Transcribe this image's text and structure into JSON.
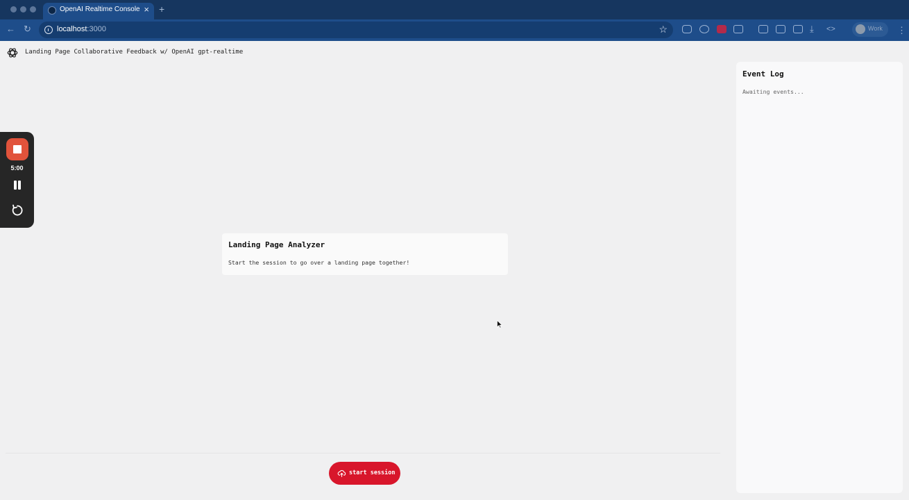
{
  "browser": {
    "tab_title": "OpenAI Realtime Console",
    "tab_close": "×",
    "new_tab": "+",
    "url_host": "localhost",
    "url_port": ":3000",
    "profile_label": "Work",
    "icons": [
      "back-icon",
      "reload-icon",
      "site-info-icon",
      "bookmark-star-icon",
      "extension-icons",
      "download-icon",
      "devtools-icon",
      "menu-icon"
    ]
  },
  "header": {
    "title": "Landing Page Collaborative Feedback w/ OpenAI gpt-realtime",
    "logo_icon": "openai-logo-icon"
  },
  "recorder": {
    "time": "5:00",
    "icons": [
      "stop-record-icon",
      "pause-icon",
      "restart-icon"
    ],
    "stop_color": "#e1533b"
  },
  "main": {
    "card_title": "Landing Page Analyzer",
    "card_subtitle": "Start the session to go over a landing page together!",
    "start_button_label": "start session",
    "start_button_color": "#d8162b",
    "start_icon": "cloud-upload-icon"
  },
  "event_log": {
    "title": "Event Log",
    "empty_text": "Awaiting events..."
  }
}
